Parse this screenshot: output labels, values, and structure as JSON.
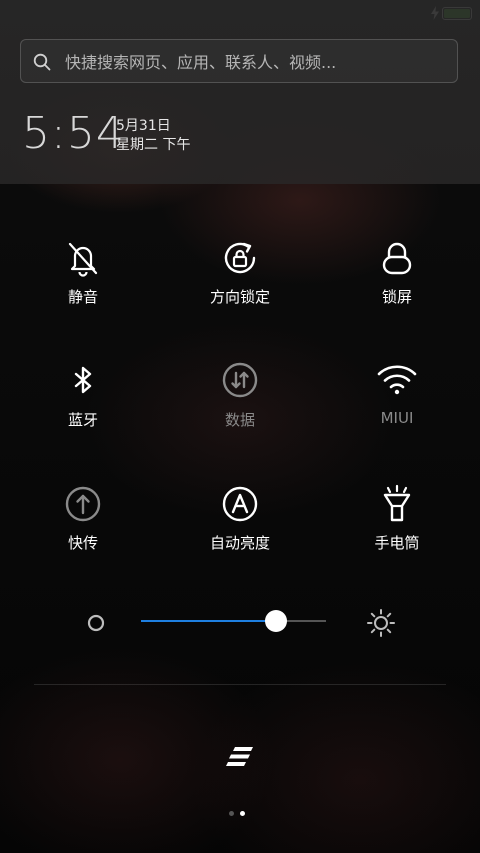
{
  "status_bar": {
    "battery_level": 1.0,
    "charging": true
  },
  "search": {
    "placeholder": "快捷搜索网页、应用、联系人、视频..."
  },
  "clock": {
    "time": "5:54",
    "date": "5月31日",
    "weekday": "星期二 下午"
  },
  "toggles": [
    {
      "label": "静音",
      "icon": "bell-off-icon",
      "state": "on"
    },
    {
      "label": "方向锁定",
      "icon": "rotation-lock-icon",
      "state": "on"
    },
    {
      "label": "锁屏",
      "icon": "lock-icon",
      "state": "on"
    },
    {
      "label": "蓝牙",
      "icon": "bluetooth-icon",
      "state": "on"
    },
    {
      "label": "数据",
      "icon": "mobile-data-icon",
      "state": "off"
    },
    {
      "label": "MIUI",
      "icon": "wifi-icon",
      "state": "off"
    },
    {
      "label": "快传",
      "icon": "share-upload-icon",
      "state": "on"
    },
    {
      "label": "自动亮度",
      "icon": "auto-brightness-icon",
      "state": "on"
    },
    {
      "label": "手电筒",
      "icon": "flashlight-icon",
      "state": "on"
    }
  ],
  "brightness": {
    "level": 0.73
  },
  "pager": {
    "total": 2,
    "current": 2
  },
  "colors": {
    "accent": "#1e7fe0",
    "battery": "#5ed234",
    "inactive_label": "#8a8a8a"
  }
}
